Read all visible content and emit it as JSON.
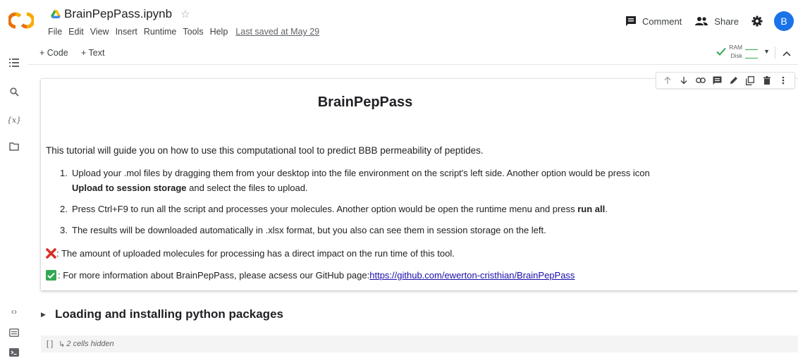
{
  "header": {
    "notebook_title": "BrainPepPass.ipynb",
    "menu": [
      "File",
      "Edit",
      "View",
      "Insert",
      "Runtime",
      "Tools",
      "Help"
    ],
    "last_saved": "Last saved at May 29",
    "comment_label": "Comment",
    "share_label": "Share",
    "avatar_letter": "B"
  },
  "toolbar": {
    "add_code": "+ Code",
    "add_text": "+ Text",
    "ram_label": "RAM",
    "disk_label": "Disk"
  },
  "cell": {
    "title": "BrainPepPass",
    "intro": "This tutorial will guide you on how to use this computational tool to predict BBB permeability of peptides.",
    "steps": [
      {
        "num": "1.",
        "text_before": "Upload your .mol files by dragging them from your desktop into the file environment on the script's left side. Another option would be press icon ",
        "bold": "Upload to session storage",
        "text_after": " and select the files to upload."
      },
      {
        "num": "2.",
        "text_before": "Press Ctrl+F9 to run all the script and processes your molecules. Another option would be open the runtime menu and press ",
        "bold": "run all",
        "text_after": "."
      },
      {
        "num": "3.",
        "text_before": "The results will be downloaded automatically in .xlsx format, but you also can see them in session storage on the left.",
        "bold": "",
        "text_after": ""
      }
    ],
    "note_warning": ": The amount of uploaded molecules for processing has a direct impact on the run time of this tool.",
    "note_info_prefix": ": For more information about BrainPepPass, please acsess our GitHub page: ",
    "note_info_link": "https://github.com/ewerton-cristhian/BrainPepPass"
  },
  "section": {
    "title": "Loading and installing python packages",
    "hidden_brackets": "[ ]",
    "hidden_arrow": "↳",
    "hidden_text": "2 cells hidden"
  },
  "colors": {
    "accent": "#1a73e8",
    "logo_orange": "#f9ab00",
    "logo_dark_orange": "#e8710a",
    "green": "#34a853",
    "red_x": "#d93025",
    "link": "#1a0dab"
  },
  "icons": {
    "sidebar": [
      "table-of-contents-icon",
      "search-icon",
      "variables-icon",
      "files-icon",
      "code-snippets-icon",
      "command-palette-icon",
      "terminal-icon"
    ],
    "cell_tools": [
      "move-up-icon",
      "move-down-icon",
      "link-icon",
      "comment-icon",
      "edit-icon",
      "mirror-cell-icon",
      "delete-icon",
      "more-icon"
    ]
  }
}
